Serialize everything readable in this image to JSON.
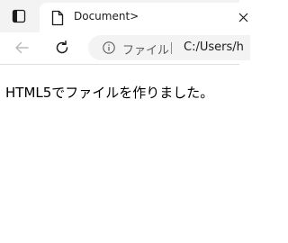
{
  "tab": {
    "title": "Document>"
  },
  "address_bar": {
    "label": "ファイル",
    "url": "C:/Users/h"
  },
  "page": {
    "text": "HTML5でファイルを作りました。"
  },
  "icons": {
    "tab_actions": "tab-actions-icon",
    "document": "document-icon",
    "back": "back-arrow-icon",
    "refresh": "refresh-icon",
    "info": "info-icon",
    "close": "close-icon"
  }
}
